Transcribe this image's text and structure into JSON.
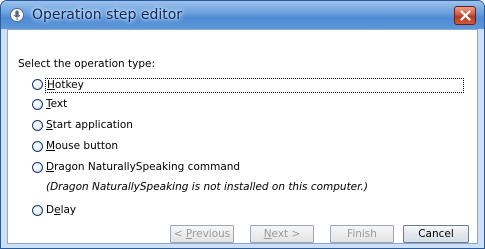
{
  "window": {
    "title": "Operation step editor",
    "icon": "microphone-icon",
    "close_icon": "close-icon"
  },
  "prompt": "Select the operation type:",
  "options": [
    {
      "pre": "",
      "key": "H",
      "post": "otkey"
    },
    {
      "pre": "",
      "key": "T",
      "post": "ext"
    },
    {
      "pre": "",
      "key": "S",
      "post": "tart application"
    },
    {
      "pre": "",
      "key": "M",
      "post": "ouse button"
    },
    {
      "pre": "",
      "key": "D",
      "post": "ragon NaturallySpeaking command"
    },
    {
      "pre": "D",
      "key": "e",
      "post": "lay"
    }
  ],
  "dragon_note": "(Dragon NaturallySpeaking is not installed on this computer.)",
  "buttons": {
    "previous": {
      "pre": "< ",
      "key": "P",
      "post": "revious"
    },
    "next": {
      "pre": "",
      "key": "N",
      "post": "ext >"
    },
    "finish": "Finish",
    "cancel": "Cancel"
  },
  "colors": {
    "titlebar": "#5c97da",
    "close_button": "#c8452f",
    "disabled_text": "#9a9a9a"
  }
}
